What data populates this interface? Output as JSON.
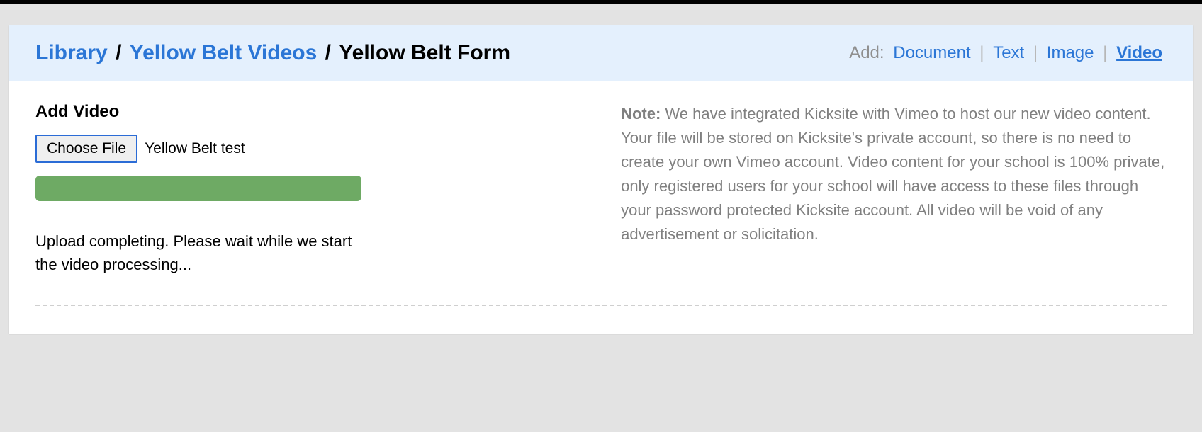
{
  "breadcrumb": {
    "library": "Library",
    "category": "Yellow Belt Videos",
    "current": "Yellow Belt Form"
  },
  "addbar": {
    "label": "Add:",
    "document": "Document",
    "text": "Text",
    "image": "Image",
    "video": "Video"
  },
  "section": {
    "title": "Add Video",
    "choose_file": "Choose File",
    "filename": "Yellow Belt test"
  },
  "upload": {
    "progress_percent": 100,
    "status_text": "Upload completing. Please wait while we start the video processing..."
  },
  "note": {
    "label": "Note:",
    "body": "We have integrated Kicksite with Vimeo to host our new video content. Your file will be stored on Kicksite's private account, so there is no need to create your own Vimeo account. Video content for your school is 100% private, only registered users for your school will have access to these files through your password protected Kicksite account. All video will be void of any advertisement or solicitation."
  },
  "colors": {
    "header_bg": "#e4f0fd",
    "link": "#2b76d6",
    "progress": "#6eaa64",
    "page_bg": "#e3e3e3"
  }
}
